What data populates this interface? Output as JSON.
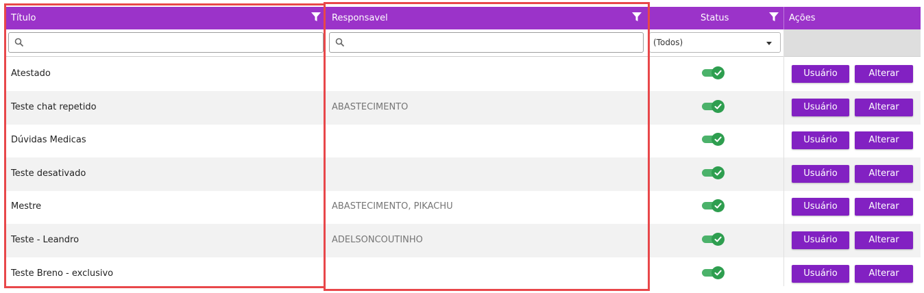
{
  "columns": {
    "titulo": "Título",
    "responsavel": "Responsavel",
    "status": "Status",
    "acoes": "Ações"
  },
  "filters": {
    "titulo_value": "",
    "responsavel_value": "",
    "status_selected": "(Todos)"
  },
  "actions": {
    "usuario": "Usuário",
    "alterar": "Alterar"
  },
  "rows": [
    {
      "titulo": "Atestado",
      "responsavel": "",
      "status_active": true
    },
    {
      "titulo": "Teste chat repetido",
      "responsavel": "ABASTECIMENTO",
      "status_active": true
    },
    {
      "titulo": "Dúvidas Medicas",
      "responsavel": "",
      "status_active": true
    },
    {
      "titulo": "Teste desativado",
      "responsavel": "",
      "status_active": true
    },
    {
      "titulo": "Mestre",
      "responsavel": "ABASTECIMENTO, PIKACHU",
      "status_active": true
    },
    {
      "titulo": "Teste - Leandro",
      "responsavel": "ADELSONCOUTINHO",
      "status_active": true
    },
    {
      "titulo": "Teste Breno - exclusivo",
      "responsavel": "",
      "status_active": true
    }
  ],
  "colors": {
    "header": "#9b33c9",
    "button": "#8221c2",
    "toggle_on": "#2e9e4f",
    "highlight": "#e8474a"
  },
  "icons": {
    "filter": "filter-icon",
    "search": "search-icon",
    "toggle": "toggle-on-check-icon"
  }
}
